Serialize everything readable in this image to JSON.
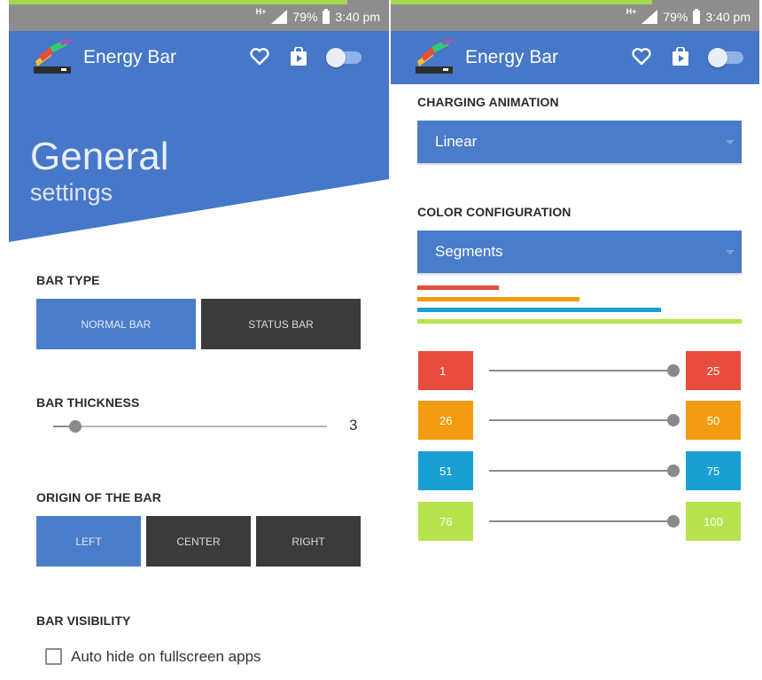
{
  "status_bar": {
    "network": "H+",
    "battery": "79%",
    "time": "3:40 pm"
  },
  "app": {
    "title": "Energy Bar"
  },
  "icons": {
    "favorite": "heart-icon",
    "store": "play-store-icon",
    "power": "toggle-switch"
  },
  "colors": {
    "primary": "#4677c8",
    "button_active": "#4a7cc9",
    "button_inactive": "#3b3b3b",
    "status_bar": "#8d8d8d",
    "red": "#e74c3c",
    "orange": "#f39c12",
    "blue": "#1a9fd3",
    "green": "#b7e34f"
  },
  "general_page": {
    "hero_title": "General",
    "hero_subtitle": "settings",
    "bar_type": {
      "label": "BAR TYPE",
      "options": [
        {
          "label": "NORMAL BAR",
          "selected": true
        },
        {
          "label": "STATUS BAR",
          "selected": false
        }
      ]
    },
    "bar_thickness": {
      "label": "BAR THICKNESS",
      "value": "3",
      "slider_fraction": 0.08
    },
    "origin": {
      "label": "ORIGIN OF THE BAR",
      "options": [
        {
          "label": "LEFT",
          "selected": true
        },
        {
          "label": "CENTER",
          "selected": false
        },
        {
          "label": "RIGHT",
          "selected": false
        }
      ]
    },
    "visibility": {
      "label": "BAR VISIBILITY",
      "checkbox_label": "Auto hide on fullscreen apps",
      "checked": false
    }
  },
  "animation_page": {
    "charging_animation": {
      "label": "CHARGING ANIMATION",
      "selected": "Linear"
    },
    "color_configuration": {
      "label": "COLOR CONFIGURATION",
      "selected": "Segments"
    },
    "preview_lines": [
      {
        "color": "#e74c3c",
        "fraction": 0.25
      },
      {
        "color": "#f39c12",
        "fraction": 0.5
      },
      {
        "color": "#1a9fd3",
        "fraction": 0.75
      },
      {
        "color": "#b7e34f",
        "fraction": 1.0
      }
    ],
    "segments": [
      {
        "from": "1",
        "to": "25",
        "color": "#e74c3c",
        "slider_fraction": 1.0
      },
      {
        "from": "26",
        "to": "50",
        "color": "#f39c12",
        "slider_fraction": 1.0
      },
      {
        "from": "51",
        "to": "75",
        "color": "#1a9fd3",
        "slider_fraction": 1.0
      },
      {
        "from": "76",
        "to": "100",
        "color": "#b7e34f",
        "slider_fraction": 1.0
      }
    ]
  }
}
